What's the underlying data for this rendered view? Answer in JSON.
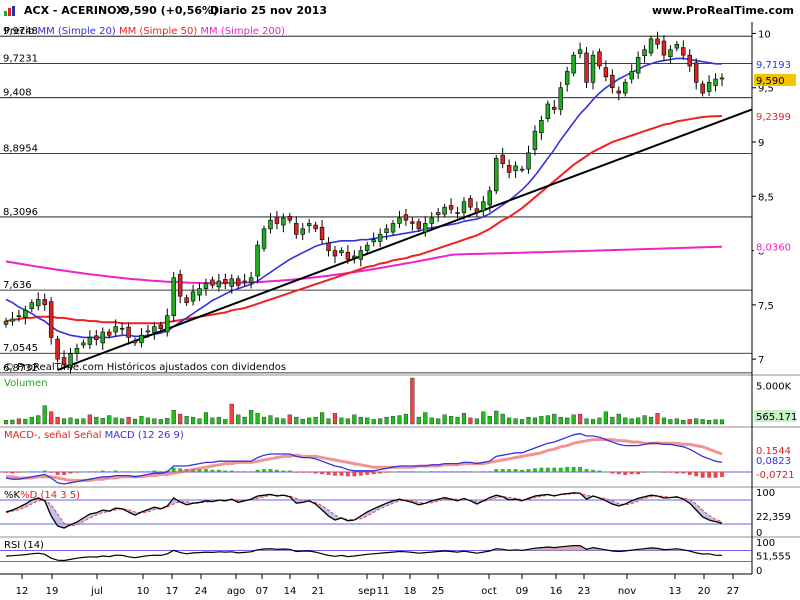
{
  "header": {
    "ticker": "ACX - ACERINOX",
    "quote": "9,590 (+0,56%)",
    "period": "Diario  25 nov 2013",
    "site": "www.ProRealTime.com"
  },
  "colors": {
    "sma20": "#3333dd",
    "sma50": "#ee2222",
    "sma200": "#ee22cc",
    "trendline": "#000000",
    "up_candle": "#22aa22",
    "down_candle": "#dd2222",
    "volume_up": "#22bb22",
    "volume_down": "#ee4444",
    "macd_line": "#3333dd",
    "signal_line": "#ee6666",
    "k_line": "#000000",
    "d_line": "#ee4444"
  },
  "chart_data": [
    {
      "type": "candlestick",
      "panel": "price",
      "legend": [
        "Precio",
        "MM (Simple 20)",
        "MM (Simple 50)",
        "MM (Simple 200)"
      ],
      "annotation": "© ProRealTime.com  Históricos ajustados con dividendos",
      "ylim": [
        6.9,
        10.05
      ],
      "y_ticks": [
        7,
        7.5,
        8,
        8.5,
        9,
        9.5,
        10
      ],
      "y_tick_labels": [
        "7",
        "7,5",
        "8",
        "8,5",
        "9",
        "9,5",
        "10"
      ],
      "horizontal_levels": [
        9.9748,
        9.7231,
        9.408,
        8.8954,
        8.3096,
        7.636,
        7.0545,
        6.8732
      ],
      "horizontal_level_labels": [
        "9,9748",
        "9,7231",
        "9,408",
        "8,8954",
        "8,3096",
        "7,636",
        "7,0545",
        "6,8732"
      ],
      "last_values": {
        "sma20": "9,7193",
        "price": "9,590",
        "sma50": "9,2399",
        "sma200": "8,0360"
      },
      "x_tick_labels": [
        "12",
        "19",
        "jul",
        "10",
        "17",
        "24",
        "ago",
        "07",
        "14",
        "21",
        "sep",
        "11",
        "18",
        "25",
        "oct",
        "09",
        "16",
        "23",
        "nov",
        "13",
        "20",
        "27"
      ],
      "closes": [
        7.35,
        7.37,
        7.4,
        7.45,
        7.52,
        7.55,
        7.5,
        7.2,
        7.0,
        6.95,
        7.05,
        7.1,
        7.15,
        7.2,
        7.18,
        7.25,
        7.22,
        7.3,
        7.28,
        7.2,
        7.15,
        7.22,
        7.26,
        7.3,
        7.28,
        7.4,
        7.75,
        7.58,
        7.52,
        7.62,
        7.65,
        7.7,
        7.68,
        7.72,
        7.7,
        7.74,
        7.68,
        7.72,
        7.75,
        8.05,
        8.2,
        8.28,
        8.25,
        8.3,
        8.28,
        8.15,
        8.2,
        8.25,
        8.2,
        8.1,
        8.0,
        7.95,
        8.0,
        7.92,
        7.95,
        8.0,
        8.05,
        8.1,
        8.15,
        8.2,
        8.25,
        8.3,
        8.28,
        8.25,
        8.2,
        8.25,
        8.3,
        8.35,
        8.4,
        8.38,
        8.35,
        8.45,
        8.4,
        8.35,
        8.45,
        8.55,
        8.85,
        8.8,
        8.72,
        8.78,
        8.75,
        8.9,
        9.1,
        9.2,
        9.35,
        9.3,
        9.5,
        9.65,
        9.8,
        9.85,
        9.55,
        9.8,
        9.7,
        9.6,
        9.5,
        9.45,
        9.55,
        9.65,
        9.78,
        9.85,
        9.95,
        9.9,
        9.8,
        9.85,
        9.9,
        9.8,
        9.7,
        9.55,
        9.45,
        9.55,
        9.58,
        9.59
      ],
      "sma20": [
        7.55,
        7.52,
        7.48,
        7.45,
        7.42,
        7.38,
        7.35,
        7.3,
        7.26,
        7.24,
        7.22,
        7.21,
        7.2,
        7.2,
        7.2,
        7.2,
        7.2,
        7.21,
        7.22,
        7.22,
        7.21,
        7.21,
        7.22,
        7.23,
        7.24,
        7.26,
        7.3,
        7.34,
        7.38,
        7.42,
        7.46,
        7.5,
        7.54,
        7.57,
        7.6,
        7.63,
        7.65,
        7.67,
        7.69,
        7.72,
        7.76,
        7.8,
        7.84,
        7.88,
        7.92,
        7.95,
        7.98,
        8.01,
        8.04,
        8.06,
        8.07,
        8.08,
        8.09,
        8.09,
        8.09,
        8.1,
        8.1,
        8.11,
        8.12,
        8.13,
        8.14,
        8.15,
        8.16,
        8.17,
        8.18,
        8.2,
        8.21,
        8.22,
        8.23,
        8.24,
        8.25,
        8.27,
        8.28,
        8.29,
        8.31,
        8.34,
        8.38,
        8.42,
        8.46,
        8.51,
        8.56,
        8.62,
        8.69,
        8.77,
        8.85,
        8.93,
        9.02,
        9.1,
        9.18,
        9.26,
        9.32,
        9.39,
        9.45,
        9.5,
        9.54,
        9.58,
        9.61,
        9.64,
        9.67,
        9.7,
        9.72,
        9.74,
        9.75,
        9.76,
        9.77,
        9.77,
        9.76,
        9.75,
        9.74,
        9.73,
        9.72,
        9.72
      ],
      "sma50": [
        7.35,
        7.36,
        7.37,
        7.38,
        7.38,
        7.39,
        7.39,
        7.39,
        7.38,
        7.38,
        7.37,
        7.36,
        7.36,
        7.35,
        7.35,
        7.34,
        7.34,
        7.34,
        7.33,
        7.33,
        7.33,
        7.33,
        7.33,
        7.33,
        7.33,
        7.34,
        7.35,
        7.36,
        7.37,
        7.38,
        7.39,
        7.4,
        7.41,
        7.42,
        7.43,
        7.45,
        7.46,
        7.47,
        7.49,
        7.51,
        7.53,
        7.55,
        7.57,
        7.59,
        7.61,
        7.63,
        7.65,
        7.67,
        7.69,
        7.71,
        7.73,
        7.75,
        7.77,
        7.79,
        7.81,
        7.83,
        7.85,
        7.86,
        7.88,
        7.89,
        7.91,
        7.92,
        7.93,
        7.95,
        7.96,
        7.98,
        8.0,
        8.02,
        8.04,
        8.06,
        8.08,
        8.1,
        8.12,
        8.14,
        8.17,
        8.2,
        8.24,
        8.28,
        8.31,
        8.35,
        8.39,
        8.44,
        8.49,
        8.54,
        8.59,
        8.64,
        8.69,
        8.74,
        8.79,
        8.83,
        8.87,
        8.91,
        8.94,
        8.97,
        9.0,
        9.02,
        9.04,
        9.06,
        9.08,
        9.1,
        9.12,
        9.14,
        9.16,
        9.17,
        9.19,
        9.2,
        9.21,
        9.22,
        9.23,
        9.235,
        9.238,
        9.2399
      ],
      "sma200_start": 7.9,
      "sma200_end": 8.036,
      "trendline": {
        "start_close_index": 8,
        "start_value": 6.9,
        "end_value": 9.3
      }
    },
    {
      "type": "bar",
      "panel": "volume",
      "legend": "Volumen",
      "y_tick_labels": [
        "5.000K"
      ],
      "ylim": [
        0,
        6000
      ],
      "last_value_label": "565.171",
      "values": [
        480,
        520,
        700,
        650,
        900,
        1100,
        2400,
        1600,
        900,
        700,
        800,
        650,
        700,
        1200,
        900,
        750,
        1100,
        800,
        700,
        900,
        650,
        1000,
        800,
        700,
        600,
        750,
        1800,
        1300,
        1000,
        900,
        700,
        1500,
        800,
        900,
        600,
        2600,
        1200,
        900,
        1800,
        1400,
        900,
        1100,
        800,
        700,
        1200,
        900,
        650,
        800,
        900,
        1500,
        700,
        1400,
        800,
        700,
        1200,
        900,
        800,
        600,
        700,
        900,
        1000,
        1100,
        1300,
        6200,
        900,
        1500,
        800,
        700,
        1200,
        1000,
        900,
        1400,
        800,
        700,
        1600,
        1000,
        1700,
        1300,
        800,
        700,
        600,
        900,
        800,
        1000,
        1100,
        1300,
        900,
        800,
        1200,
        1300,
        700,
        600,
        800,
        1600,
        900,
        1300,
        800,
        700,
        800,
        1100,
        900,
        1400,
        800,
        600,
        700,
        500,
        600,
        700,
        600,
        500,
        580,
        565
      ],
      "down_indices": [
        2,
        7,
        8,
        13,
        19,
        27,
        35,
        44,
        51,
        63,
        72,
        89,
        101,
        106
      ]
    },
    {
      "type": "line",
      "panel": "macd",
      "legend": [
        "MACD-, señal",
        "Señal",
        "MACD (12 26 9)"
      ],
      "last_value_labels": [
        "0,1544",
        "0,0823",
        "-0,0721"
      ],
      "ylim": [
        -0.1,
        0.35
      ],
      "macd": [
        -0.05,
        -0.06,
        -0.06,
        -0.05,
        -0.04,
        -0.03,
        -0.02,
        -0.05,
        -0.09,
        -0.1,
        -0.09,
        -0.08,
        -0.07,
        -0.06,
        -0.05,
        -0.04,
        -0.04,
        -0.03,
        -0.03,
        -0.03,
        -0.04,
        -0.03,
        -0.02,
        -0.01,
        -0.01,
        0.0,
        0.05,
        0.05,
        0.05,
        0.06,
        0.07,
        0.08,
        0.08,
        0.09,
        0.09,
        0.09,
        0.09,
        0.09,
        0.09,
        0.12,
        0.14,
        0.15,
        0.15,
        0.15,
        0.15,
        0.13,
        0.12,
        0.12,
        0.11,
        0.09,
        0.07,
        0.05,
        0.04,
        0.02,
        0.01,
        0.01,
        0.01,
        0.01,
        0.02,
        0.03,
        0.04,
        0.05,
        0.05,
        0.05,
        0.05,
        0.05,
        0.06,
        0.06,
        0.07,
        0.07,
        0.07,
        0.08,
        0.08,
        0.07,
        0.08,
        0.09,
        0.13,
        0.14,
        0.15,
        0.16,
        0.16,
        0.18,
        0.2,
        0.22,
        0.24,
        0.25,
        0.27,
        0.29,
        0.31,
        0.32,
        0.3,
        0.3,
        0.29,
        0.27,
        0.25,
        0.23,
        0.22,
        0.22,
        0.22,
        0.23,
        0.24,
        0.24,
        0.23,
        0.23,
        0.22,
        0.21,
        0.19,
        0.16,
        0.13,
        0.11,
        0.09,
        0.08
      ],
      "signal": [
        -0.04,
        -0.04,
        -0.05,
        -0.05,
        -0.05,
        -0.04,
        -0.04,
        -0.04,
        -0.05,
        -0.06,
        -0.07,
        -0.07,
        -0.07,
        -0.07,
        -0.06,
        -0.06,
        -0.05,
        -0.05,
        -0.04,
        -0.04,
        -0.04,
        -0.04,
        -0.03,
        -0.03,
        -0.02,
        -0.02,
        -0.01,
        0.0,
        0.01,
        0.02,
        0.03,
        0.04,
        0.05,
        0.06,
        0.07,
        0.07,
        0.08,
        0.08,
        0.08,
        0.09,
        0.1,
        0.11,
        0.12,
        0.13,
        0.13,
        0.14,
        0.13,
        0.13,
        0.13,
        0.12,
        0.11,
        0.1,
        0.09,
        0.08,
        0.07,
        0.06,
        0.05,
        0.04,
        0.04,
        0.04,
        0.04,
        0.04,
        0.04,
        0.04,
        0.05,
        0.05,
        0.05,
        0.05,
        0.06,
        0.06,
        0.06,
        0.07,
        0.07,
        0.07,
        0.07,
        0.08,
        0.09,
        0.1,
        0.11,
        0.12,
        0.13,
        0.14,
        0.15,
        0.16,
        0.18,
        0.19,
        0.21,
        0.22,
        0.24,
        0.25,
        0.26,
        0.27,
        0.27,
        0.27,
        0.27,
        0.26,
        0.26,
        0.25,
        0.25,
        0.24,
        0.24,
        0.24,
        0.24,
        0.24,
        0.24,
        0.23,
        0.23,
        0.22,
        0.21,
        0.19,
        0.17,
        0.15
      ]
    },
    {
      "type": "line",
      "panel": "stochastic",
      "legend": [
        "%K",
        "%D (14 3 5)"
      ],
      "y_tick_labels": [
        "100",
        "0"
      ],
      "last_value_label": "22,359",
      "ylim": [
        0,
        100
      ],
      "levels": [
        80,
        20
      ],
      "k": [
        50,
        55,
        62,
        70,
        80,
        85,
        78,
        40,
        15,
        10,
        18,
        25,
        35,
        45,
        48,
        55,
        52,
        60,
        58,
        50,
        42,
        50,
        56,
        62,
        58,
        65,
        85,
        75,
        68,
        72,
        74,
        78,
        76,
        80,
        78,
        82,
        74,
        78,
        82,
        90,
        92,
        94,
        90,
        92,
        88,
        72,
        74,
        78,
        70,
        55,
        40,
        30,
        35,
        28,
        30,
        40,
        50,
        58,
        65,
        72,
        78,
        82,
        78,
        74,
        68,
        72,
        78,
        82,
        86,
        82,
        78,
        84,
        78,
        70,
        78,
        86,
        92,
        88,
        80,
        82,
        78,
        84,
        90,
        92,
        94,
        90,
        94,
        96,
        98,
        97,
        82,
        90,
        85,
        78,
        70,
        65,
        70,
        78,
        84,
        88,
        92,
        90,
        85,
        86,
        88,
        82,
        72,
        55,
        38,
        30,
        26,
        22
      ],
      "d": [
        48,
        52,
        56,
        62,
        70,
        78,
        80,
        68,
        45,
        22,
        15,
        18,
        26,
        35,
        42,
        48,
        52,
        55,
        58,
        56,
        50,
        48,
        50,
        56,
        58,
        62,
        70,
        76,
        76,
        72,
        72,
        75,
        76,
        78,
        78,
        80,
        78,
        78,
        80,
        84,
        88,
        92,
        92,
        92,
        90,
        84,
        78,
        76,
        74,
        66,
        55,
        42,
        35,
        31,
        31,
        33,
        40,
        49,
        58,
        65,
        72,
        78,
        79,
        78,
        74,
        72,
        73,
        77,
        82,
        83,
        82,
        82,
        80,
        76,
        76,
        80,
        86,
        88,
        87,
        84,
        81,
        82,
        86,
        89,
        92,
        92,
        93,
        94,
        96,
        97,
        92,
        89,
        86,
        84,
        78,
        71,
        68,
        71,
        77,
        84,
        88,
        90,
        89,
        87,
        86,
        85,
        81,
        70,
        55,
        41,
        32,
        26
      ]
    },
    {
      "type": "line",
      "panel": "rsi",
      "legend": "RSI (14)",
      "y_tick_labels": [
        "100",
        "0"
      ],
      "last_value_label": "51,555",
      "ylim": [
        0,
        100
      ],
      "levels": [
        70,
        30
      ],
      "values": [
        50,
        51,
        53,
        55,
        58,
        60,
        56,
        42,
        35,
        34,
        38,
        42,
        45,
        47,
        46,
        50,
        48,
        53,
        52,
        47,
        44,
        48,
        51,
        53,
        52,
        58,
        70,
        62,
        58,
        61,
        62,
        64,
        63,
        65,
        64,
        65,
        61,
        63,
        65,
        72,
        75,
        76,
        74,
        75,
        74,
        66,
        67,
        68,
        64,
        58,
        52,
        49,
        52,
        48,
        50,
        53,
        56,
        58,
        60,
        62,
        64,
        66,
        65,
        63,
        60,
        62,
        64,
        66,
        68,
        66,
        64,
        67,
        64,
        60,
        64,
        68,
        76,
        74,
        70,
        72,
        70,
        74,
        78,
        80,
        82,
        80,
        83,
        85,
        87,
        87,
        74,
        80,
        76,
        72,
        68,
        66,
        68,
        71,
        74,
        76,
        79,
        77,
        73,
        74,
        76,
        72,
        68,
        61,
        57,
        58,
        53,
        52
      ]
    }
  ]
}
